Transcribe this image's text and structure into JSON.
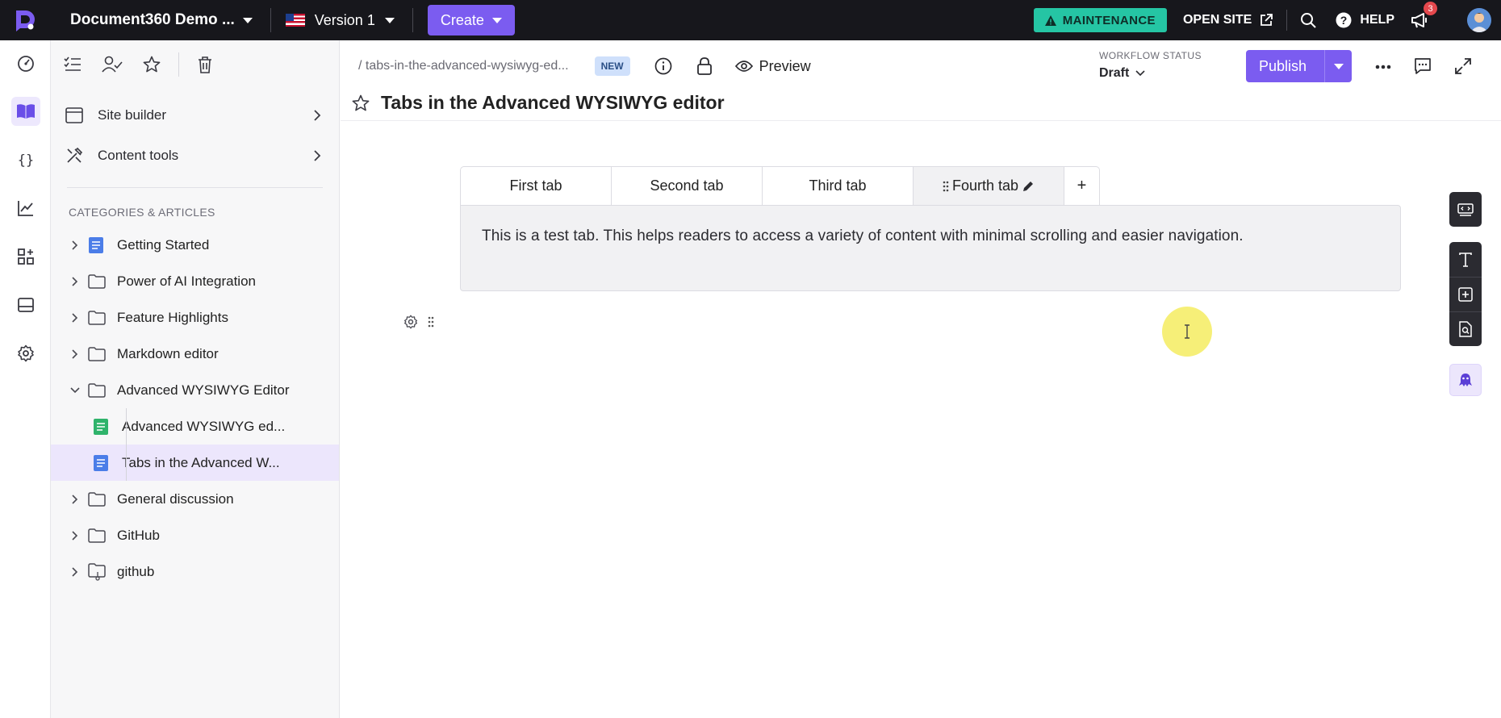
{
  "topbar": {
    "project_name": "Document360 Demo ...",
    "version_label": "Version 1",
    "create_label": "Create",
    "maintenance_label": "MAINTENANCE",
    "open_site_label": "OPEN SITE",
    "help_label": "HELP",
    "notification_count": "3"
  },
  "rail": {
    "items": [
      "dashboard-icon",
      "documentation-icon",
      "api-icon",
      "analytics-icon",
      "integrations-icon",
      "widgets-icon",
      "settings-icon"
    ],
    "active": "documentation-icon"
  },
  "sidebar": {
    "tools": [
      "all-articles-icon",
      "my-assignments-icon",
      "starred-icon",
      "recycle-bin-icon"
    ],
    "nav": [
      {
        "label": "Site builder"
      },
      {
        "label": "Content tools"
      }
    ],
    "categories_heading": "CATEGORIES & ARTICLES",
    "tree": [
      {
        "label": "Getting Started",
        "icon": "page-icon",
        "expanded": false
      },
      {
        "label": "Power of AI Integration",
        "icon": "folder-icon",
        "expanded": false
      },
      {
        "label": "Feature Highlights",
        "icon": "folder-icon",
        "expanded": false
      },
      {
        "label": "Markdown editor",
        "icon": "folder-icon",
        "expanded": false
      },
      {
        "label": "Advanced WYSIWYG Editor",
        "icon": "folder-icon",
        "expanded": true,
        "children": [
          {
            "label": "Advanced WYSIWYG ed...",
            "icon": "article-green-icon"
          },
          {
            "label": "Tabs in the Advanced W...",
            "icon": "article-blue-icon",
            "selected": true
          }
        ]
      },
      {
        "label": "General discussion",
        "icon": "folder-icon",
        "expanded": false
      },
      {
        "label": "GitHub",
        "icon": "folder-icon",
        "expanded": false
      },
      {
        "label": "github",
        "icon": "linked-folder-icon",
        "expanded": false
      }
    ]
  },
  "header": {
    "slug": "/ tabs-in-the-advanced-wysiwyg-ed...",
    "new_badge": "NEW",
    "preview_label": "Preview",
    "workflow_status_label": "WORKFLOW STATUS",
    "workflow_status_value": "Draft",
    "publish_label": "Publish",
    "article_title": "Tabs in the Advanced WYSIWYG editor"
  },
  "editor": {
    "tabs": [
      {
        "label": "First tab"
      },
      {
        "label": "Second tab"
      },
      {
        "label": "Third tab"
      },
      {
        "label": "Fourth tab",
        "active": true
      }
    ],
    "add_tab_label": "+",
    "tab_content": "This is a test tab. This helps readers to access a variety of content with minimal scrolling and easier navigation."
  },
  "right_tools": [
    "embed-icon",
    "text-format-icon",
    "insert-block-icon",
    "find-in-document-icon",
    "eddy-ai-icon"
  ],
  "colors": {
    "topbar_bg": "#17171c",
    "accent": "#7b5cf0",
    "maintenance": "#25c5a4",
    "selected_row": "#ece6fc",
    "badge": "#e5484d"
  }
}
